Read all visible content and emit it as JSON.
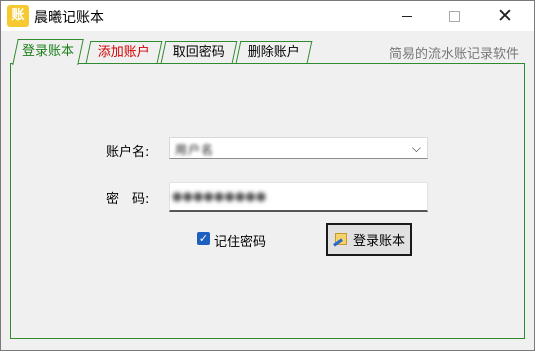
{
  "window": {
    "title": "晨曦记账本",
    "app_icon_glyph": "账"
  },
  "tabs": [
    {
      "label": "登录账本",
      "active": true,
      "color": "#1a7f1a"
    },
    {
      "label": "添加账户",
      "active": false,
      "color": "#d40000"
    },
    {
      "label": "取回密码",
      "active": false,
      "color": "#000000"
    },
    {
      "label": "删除账户",
      "active": false,
      "color": "#000000"
    }
  ],
  "tagline": "简易的流水账记录软件",
  "form": {
    "account_label": "账户名:",
    "account_value": "用户名",
    "password_label": "密　码:",
    "password_value": "●●●●●●●●●",
    "remember_label": "记住密码",
    "remember_checked": true,
    "login_button": "登录账本"
  },
  "colors": {
    "tab_border": "#2e8b2e",
    "checkbox": "#1f5fbf"
  }
}
